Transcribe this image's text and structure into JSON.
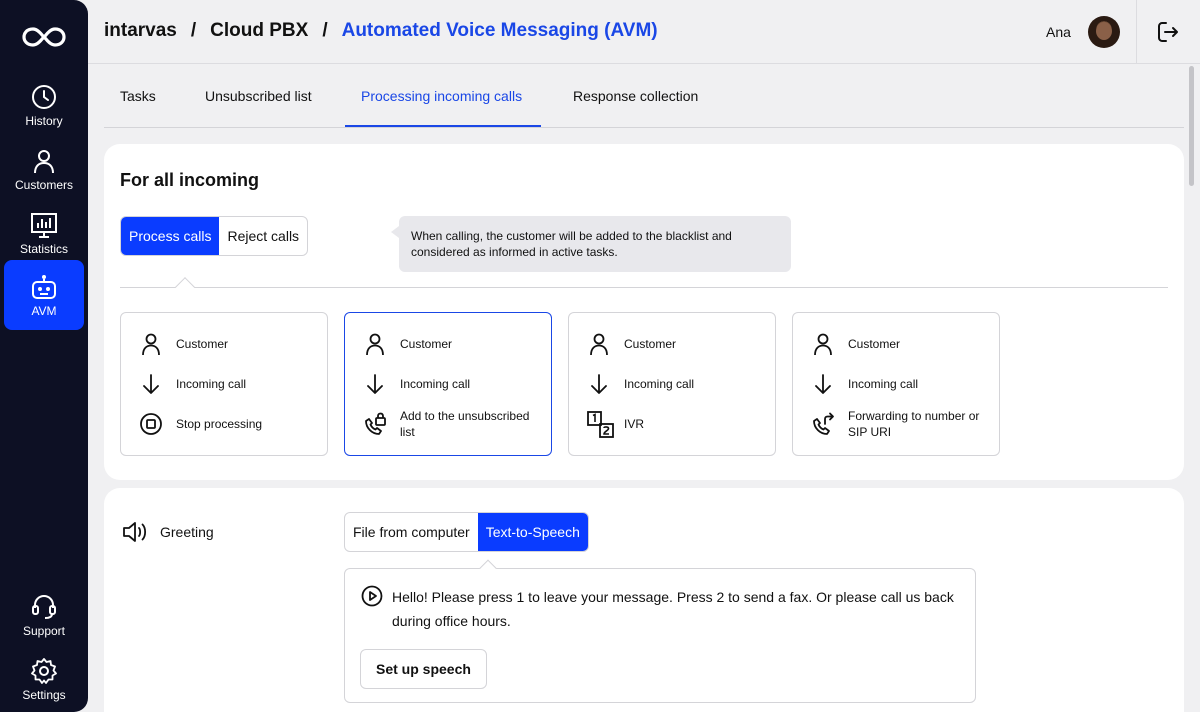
{
  "sidebar": {
    "items": [
      {
        "label": "History",
        "icon": "clock-icon"
      },
      {
        "label": "Customers",
        "icon": "person-icon"
      },
      {
        "label": "Statistics",
        "icon": "chart-icon"
      },
      {
        "label": "AVM",
        "icon": "robot-icon",
        "active": true
      },
      {
        "label": "Support",
        "icon": "headset-icon"
      },
      {
        "label": "Settings",
        "icon": "gear-icon"
      }
    ]
  },
  "header": {
    "breadcrumb": [
      "intarvas",
      "Cloud PBX",
      "Automated Voice Messaging (AVM)"
    ],
    "separator": "/",
    "user_name": "Ana"
  },
  "tabs": [
    {
      "label": "Tasks"
    },
    {
      "label": "Unsubscribed list"
    },
    {
      "label": "Processing incoming calls",
      "active": true
    },
    {
      "label": "Response collection"
    }
  ],
  "incoming": {
    "title": "For all incoming",
    "mode_options": [
      "Process calls",
      "Reject calls"
    ],
    "selected_mode": "Process calls",
    "tooltip": "When calling, the customer will be added to the blacklist and considered as informed in active tasks.",
    "cards": [
      {
        "customer": "Customer",
        "call": "Incoming call",
        "action": "Stop processing",
        "action_icon": "stop-icon"
      },
      {
        "customer": "Customer",
        "call": "Incoming call",
        "action": "Add to the unsubscribed list",
        "action_icon": "phone-lock-icon",
        "selected": true
      },
      {
        "customer": "Customer",
        "call": "Incoming call",
        "action": "IVR",
        "action_icon": "ivr-icon"
      },
      {
        "customer": "Customer",
        "call": "Incoming call",
        "action": "Forwarding to number or SIP URI",
        "action_icon": "phone-forward-icon"
      }
    ]
  },
  "greeting": {
    "label": "Greeting",
    "source_options": [
      "File from computer",
      "Text-to-Speech"
    ],
    "selected_source": "Text-to-Speech",
    "text": "Hello! Please press 1 to leave your message. Press 2 to send a fax. Or please call us back during office hours.",
    "setup_button": "Set up speech"
  },
  "colors": {
    "accent": "#0a3cff",
    "sidebar_bg": "#0d1024",
    "link": "#1a47e6"
  }
}
